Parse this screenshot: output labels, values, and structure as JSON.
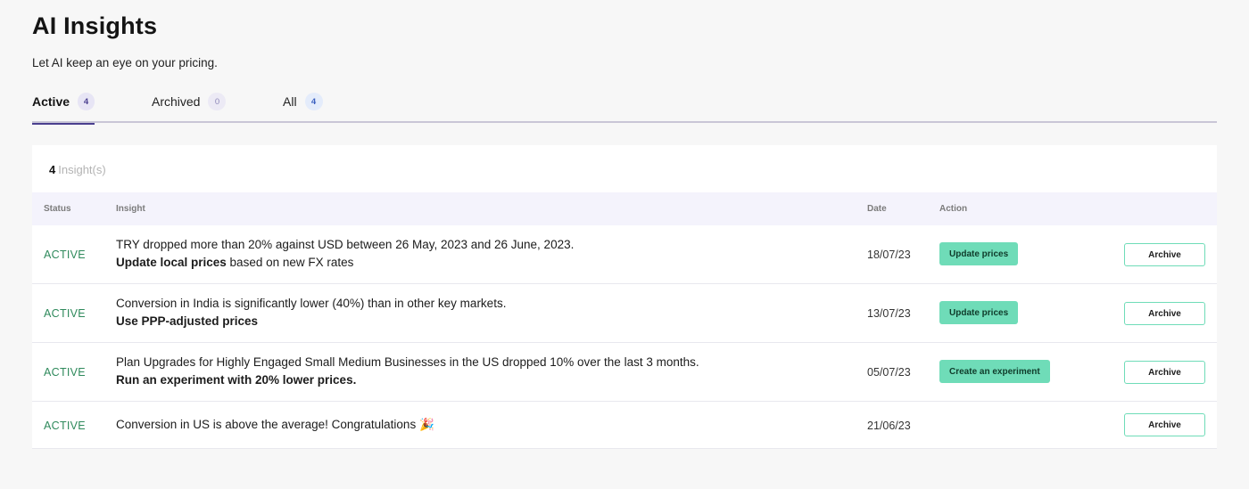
{
  "header": {
    "title": "AI Insights",
    "subtitle": "Let AI keep an eye on your pricing."
  },
  "tabs": [
    {
      "label": "Active",
      "count": "4",
      "active": true
    },
    {
      "label": "Archived",
      "count": "0",
      "active": false
    },
    {
      "label": "All",
      "count": "4",
      "active": false
    }
  ],
  "summary": {
    "count": "4",
    "label": "Insight(s)"
  },
  "table": {
    "columns": {
      "status": "Status",
      "insight": "Insight",
      "date": "Date",
      "action": "Action"
    },
    "rows": [
      {
        "status": "ACTIVE",
        "insight": "TRY dropped more than 20% against USD between 26 May, 2023 and 26 June, 2023.",
        "recommendation_bold": "Update local prices",
        "recommendation_rest": " based on new FX rates",
        "date": "18/07/23",
        "action": "Update prices",
        "archive": "Archive"
      },
      {
        "status": "ACTIVE",
        "insight": "Conversion in India is significantly lower (40%) than in other key markets.",
        "recommendation_bold": "Use PPP-adjusted prices",
        "recommendation_rest": "",
        "date": "13/07/23",
        "action": "Update prices",
        "archive": "Archive"
      },
      {
        "status": "ACTIVE",
        "insight": "Plan Upgrades for Highly Engaged Small Medium Businesses  in the US dropped 10% over the last 3 months.",
        "recommendation_bold": "Run an experiment with 20% lower prices.",
        "recommendation_rest": "",
        "date": "05/07/23",
        "action": "Create an experiment",
        "archive": "Archive"
      },
      {
        "status": "ACTIVE",
        "insight": "Conversion in US is above the average! Congratulations",
        "emoji": "🎉",
        "date": "21/06/23",
        "archive": "Archive"
      }
    ]
  },
  "colors": {
    "accent": "#4a3f8f",
    "status_active": "#2f8a5c",
    "action_button": "#6fdcb8",
    "table_header_bg": "#f4f3fc"
  }
}
